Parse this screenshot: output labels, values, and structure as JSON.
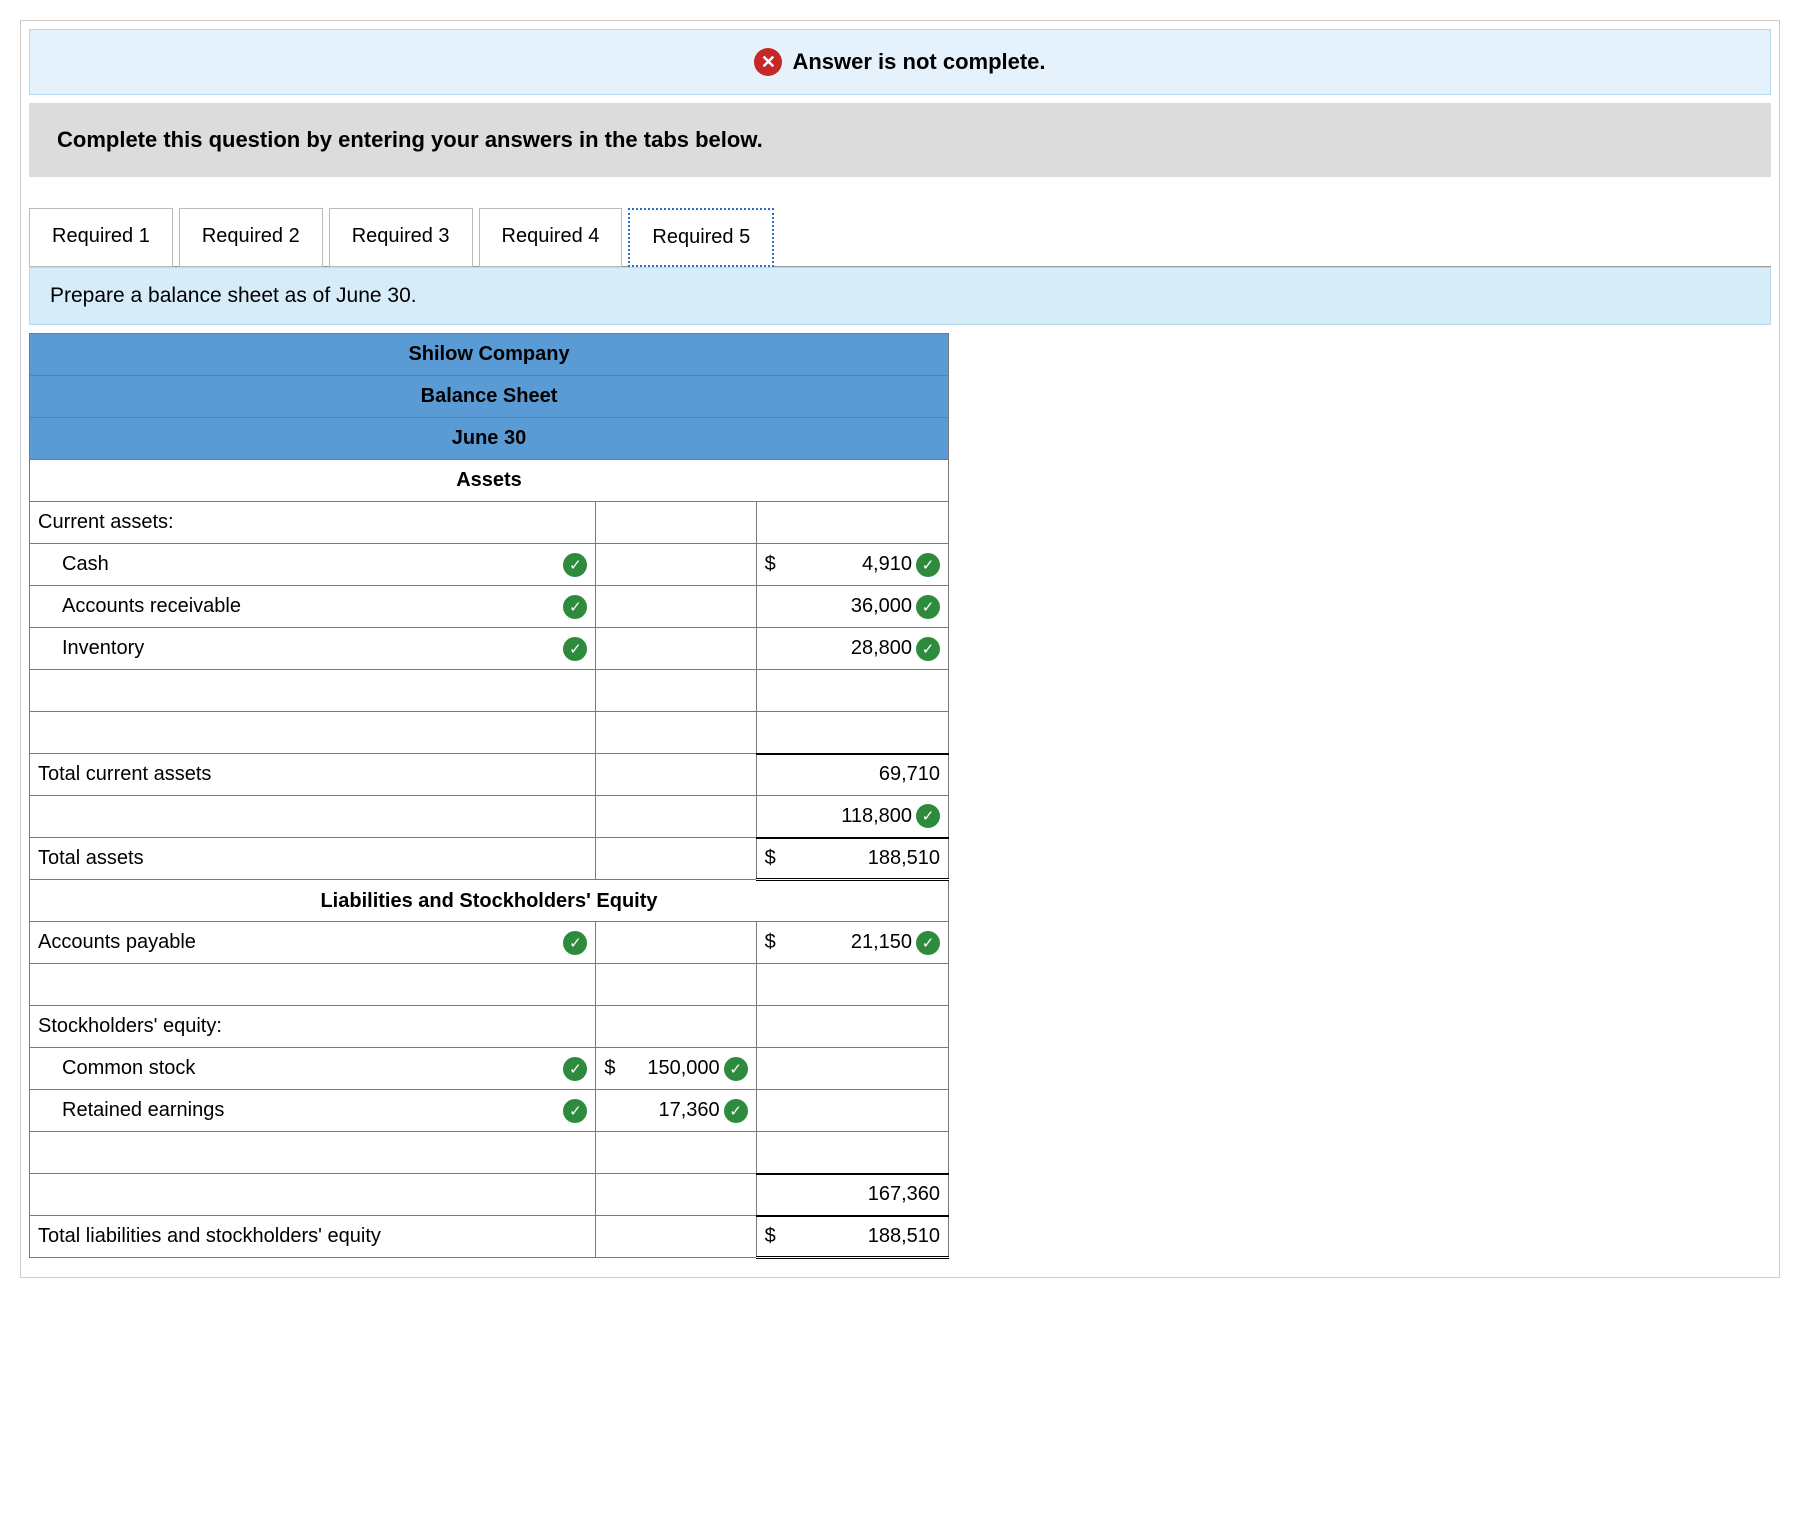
{
  "status": {
    "text": "Answer is not complete."
  },
  "instruction": "Complete this question by entering your answers in the tabs below.",
  "tabs": [
    {
      "label": "Required 1"
    },
    {
      "label": "Required 2"
    },
    {
      "label": "Required 3"
    },
    {
      "label": "Required 4"
    },
    {
      "label": "Required 5"
    }
  ],
  "prompt": "Prepare a balance sheet as of June 30.",
  "sheet": {
    "company": "Shilow Company",
    "title": "Balance Sheet",
    "date": "June 30",
    "assets_header": "Assets",
    "current_assets_label": "Current assets:",
    "rows": {
      "cash": {
        "label": "Cash",
        "currency": "$",
        "value": "4,910"
      },
      "ar": {
        "label": "Accounts receivable",
        "value": "36,000"
      },
      "inventory": {
        "label": "Inventory",
        "value": "28,800"
      },
      "total_current": {
        "label": "Total current assets",
        "value": "69,710"
      },
      "other_asset": {
        "value": "118,800"
      },
      "total_assets": {
        "label": "Total assets",
        "currency": "$",
        "value": "188,510"
      }
    },
    "liab_header": "Liabilities and Stockholders' Equity",
    "liab_rows": {
      "ap": {
        "label": "Accounts payable",
        "currency": "$",
        "value": "21,150"
      },
      "se_label": "Stockholders' equity:",
      "common": {
        "label": "Common stock",
        "currency": "$",
        "value": "150,000"
      },
      "retained": {
        "label": "Retained earnings",
        "value": "17,360"
      },
      "total_se": {
        "value": "167,360"
      },
      "total_liab_se": {
        "label": "Total liabilities and stockholders' equity",
        "currency": "$",
        "value": "188,510"
      }
    }
  }
}
